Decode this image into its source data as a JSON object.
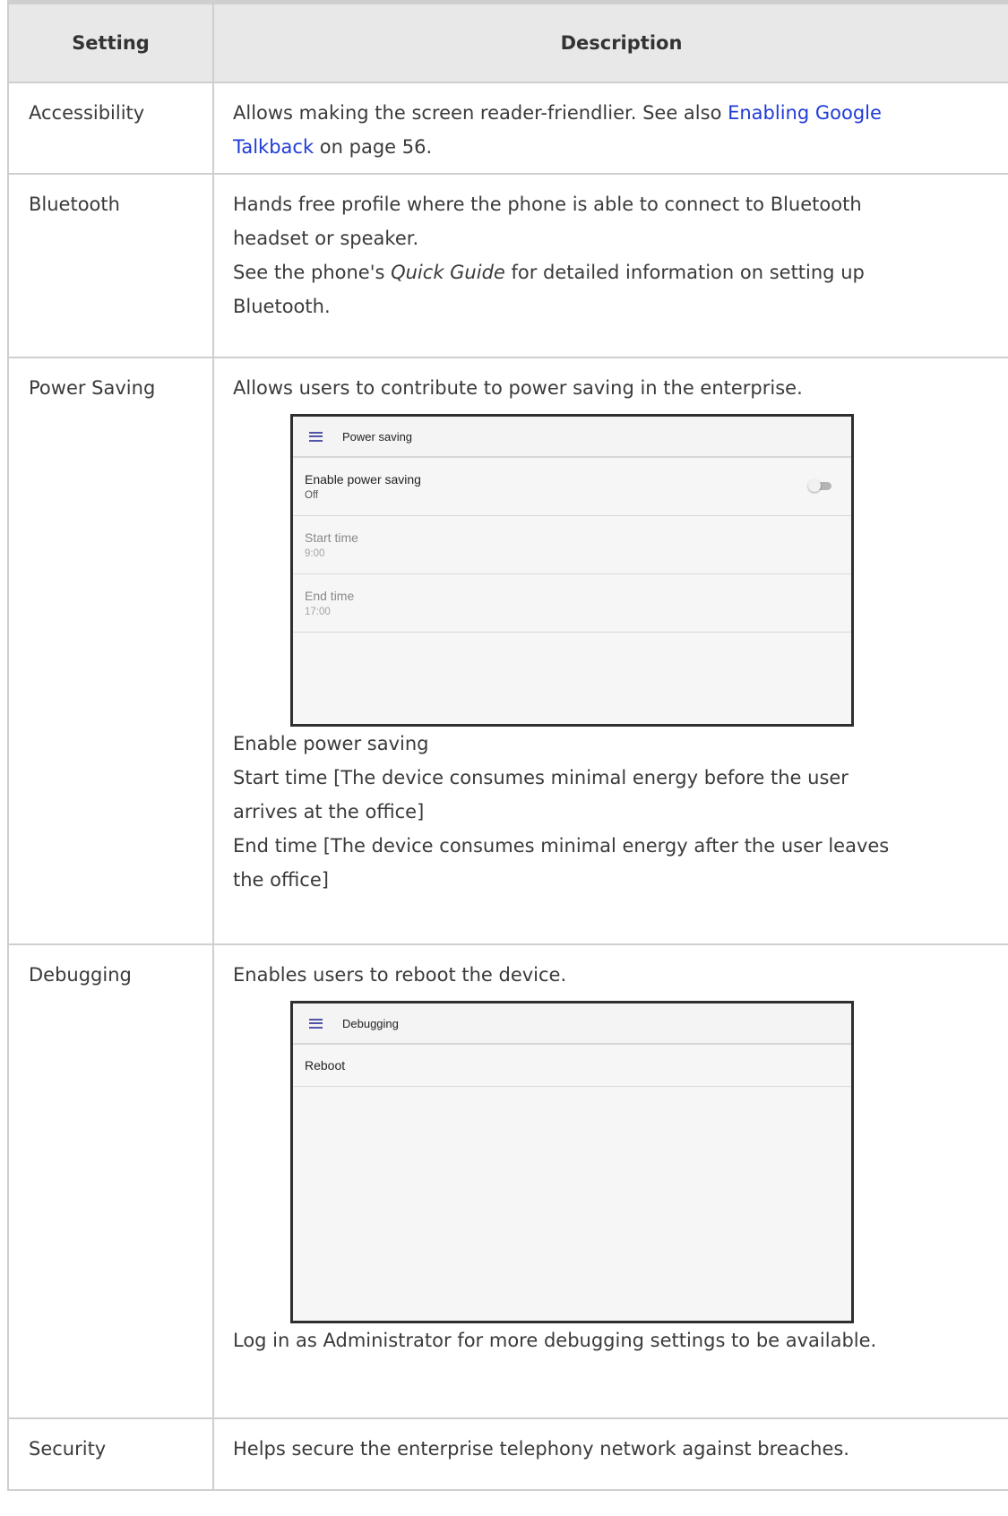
{
  "table": {
    "headers": {
      "setting": "Setting",
      "description": "Description"
    },
    "rows": {
      "accessibility": {
        "name": "Accessibility",
        "desc_prefix": "Allows making the screen reader-friendlier. See also ",
        "link_line1": "Enabling Google",
        "link_line2": "Talkback",
        "desc_suffix": " on page 56."
      },
      "bluetooth": {
        "name": "Bluetooth",
        "line1": "Hands free profile where the phone is able to connect to Bluetooth",
        "line2": "headset or speaker.",
        "line3_prefix": "See the phone's ",
        "line3_italic": "Quick Guide",
        "line3_suffix": " for detailed information on setting up",
        "line4": "Bluetooth."
      },
      "power_saving": {
        "name": "Power Saving",
        "intro": "Allows users to contribute to power saving in the enterprise.",
        "screenshot": {
          "header_title": "Power saving",
          "items": [
            {
              "title": "Enable power saving",
              "value": "Off"
            },
            {
              "title": "Start time",
              "value": "9:00"
            },
            {
              "title": "End time",
              "value": "17:00"
            }
          ],
          "toggle_on": false
        },
        "line_enable": "Enable power saving",
        "line_start1": "Start time [The device consumes minimal energy before the user",
        "line_start2": "arrives at the office]",
        "line_end1": "End time [The device consumes minimal energy after the user leaves",
        "line_end2": "the office]"
      },
      "debugging": {
        "name": "Debugging",
        "intro": "Enables users to reboot the device.",
        "screenshot": {
          "header_title": "Debugging",
          "items": [
            {
              "title": "Reboot"
            }
          ]
        },
        "note": "Log in as Administrator for more debugging settings to be available."
      },
      "security": {
        "name": "Security",
        "desc": "Helps secure the enterprise telephony network against breaches."
      }
    }
  }
}
